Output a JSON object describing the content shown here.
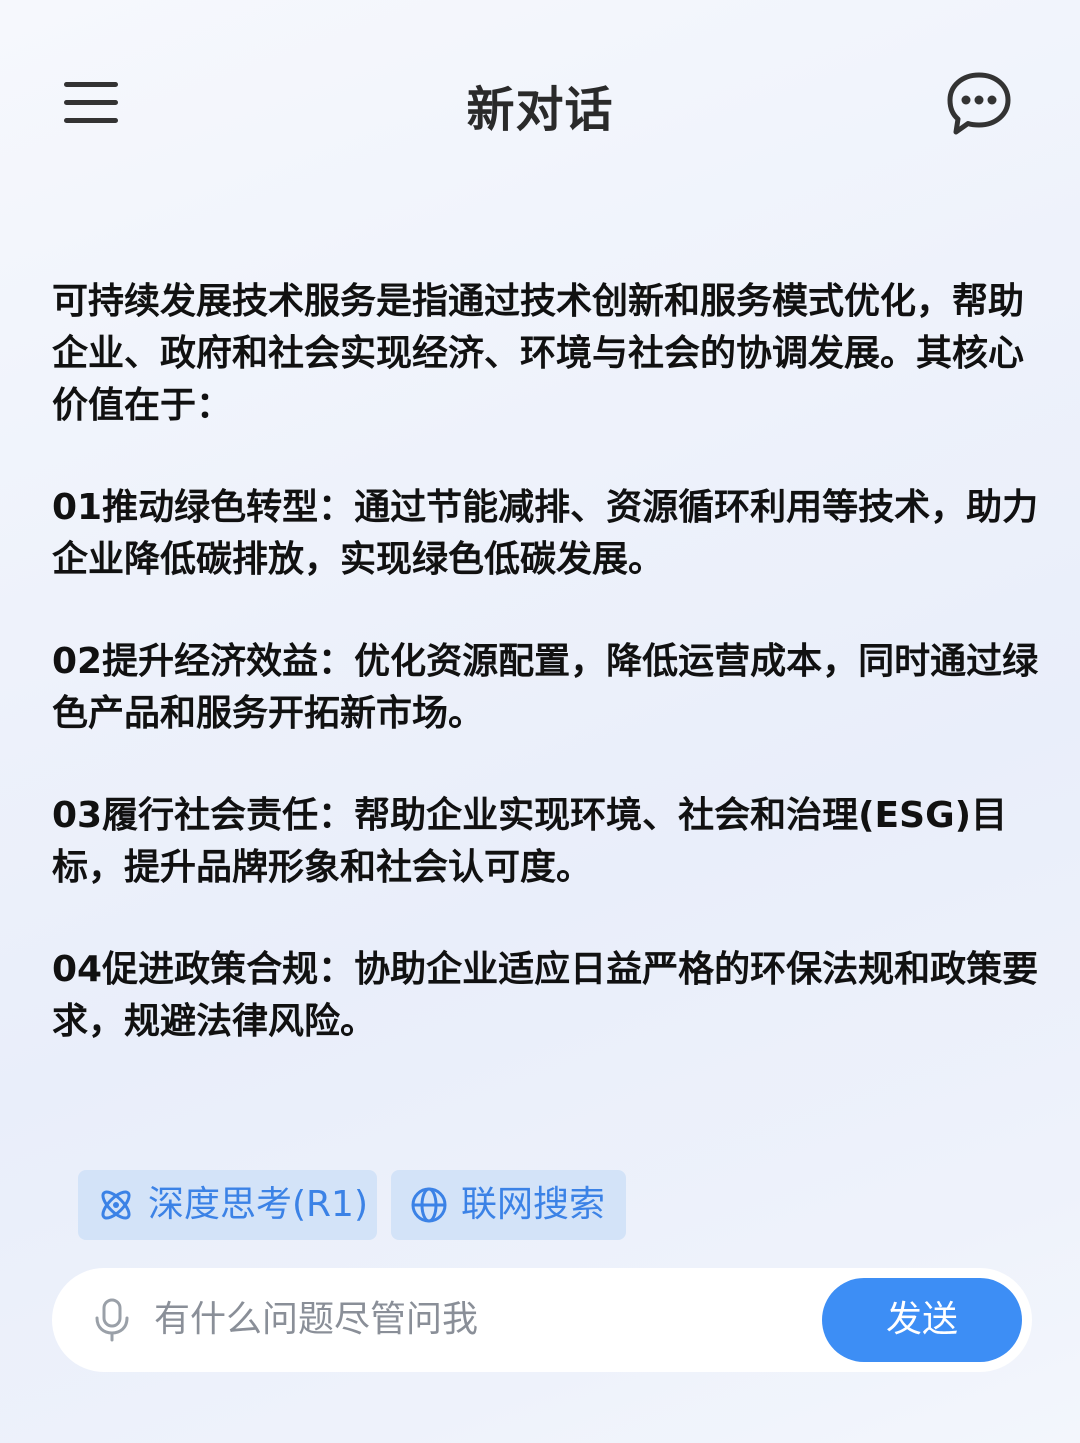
{
  "header": {
    "title": "新对话",
    "menu_icon": "hamburger-menu-icon",
    "chat_icon": "chat-bubble-icon"
  },
  "message": {
    "intro": "可持续发展技术服务是指通过技术创新和服务模式优化，帮助企业、政府和社会实现经济、环境与社会的协调发展。其核心价值在于：",
    "points": [
      "01推动绿色转型：通过节能减排、资源循环利用等技术，助力企业降低碳排放，实现绿色低碳发展。",
      "02提升经济效益：优化资源配置，降低运营成本，同时通过绿色产品和服务开拓新市场。",
      "03履行社会责任：帮助企业实现环境、社会和治理(ESG)目标，提升品牌形象和社会认可度。",
      "04促进政策合规：协助企业适应日益严格的环保法规和政策要求，规避法律风险。"
    ]
  },
  "chips": {
    "deep_think": "深度思考(R1)",
    "web_search": "联网搜索"
  },
  "input": {
    "placeholder": "有什么问题尽管问我",
    "send_label": "发送"
  },
  "colors": {
    "accent": "#3d8ef5",
    "chip_bg": "#d3e3f8",
    "chip_text": "#3b82e6"
  }
}
